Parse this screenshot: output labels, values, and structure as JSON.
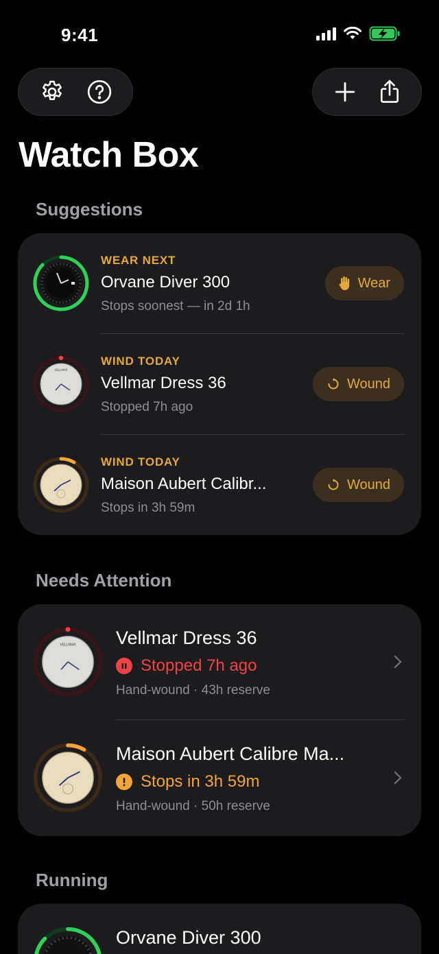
{
  "status_bar": {
    "time": "9:41"
  },
  "header": {
    "title": "Watch Box"
  },
  "suggestions": {
    "title": "Suggestions",
    "items": [
      {
        "kicker": "WEAR NEXT",
        "name": "Orvane Diver 300",
        "detail": "Stops soonest — in 2d 1h",
        "action": "Wear"
      },
      {
        "kicker": "WIND TODAY",
        "name": "Vellmar Dress 36",
        "detail": "Stopped 7h ago",
        "action": "Wound"
      },
      {
        "kicker": "WIND TODAY",
        "name": "Maison Aubert Calibr...",
        "detail": "Stops in 3h 59m",
        "action": "Wound"
      }
    ]
  },
  "attention": {
    "title": "Needs Attention",
    "items": [
      {
        "name": "Vellmar Dress 36",
        "status": "Stopped 7h ago",
        "detail": "Hand-wound · 43h reserve"
      },
      {
        "name": "Maison Aubert Calibre Ma...",
        "status": "Stops in 3h 59m",
        "detail": "Hand-wound · 50h reserve"
      }
    ]
  },
  "running": {
    "title": "Running",
    "items": [
      {
        "name": "Orvane Diver 300"
      }
    ]
  },
  "colors": {
    "accent": "#e7a83b",
    "danger": "#f04444",
    "warning": "#f5a33b",
    "ok": "#30d158"
  }
}
